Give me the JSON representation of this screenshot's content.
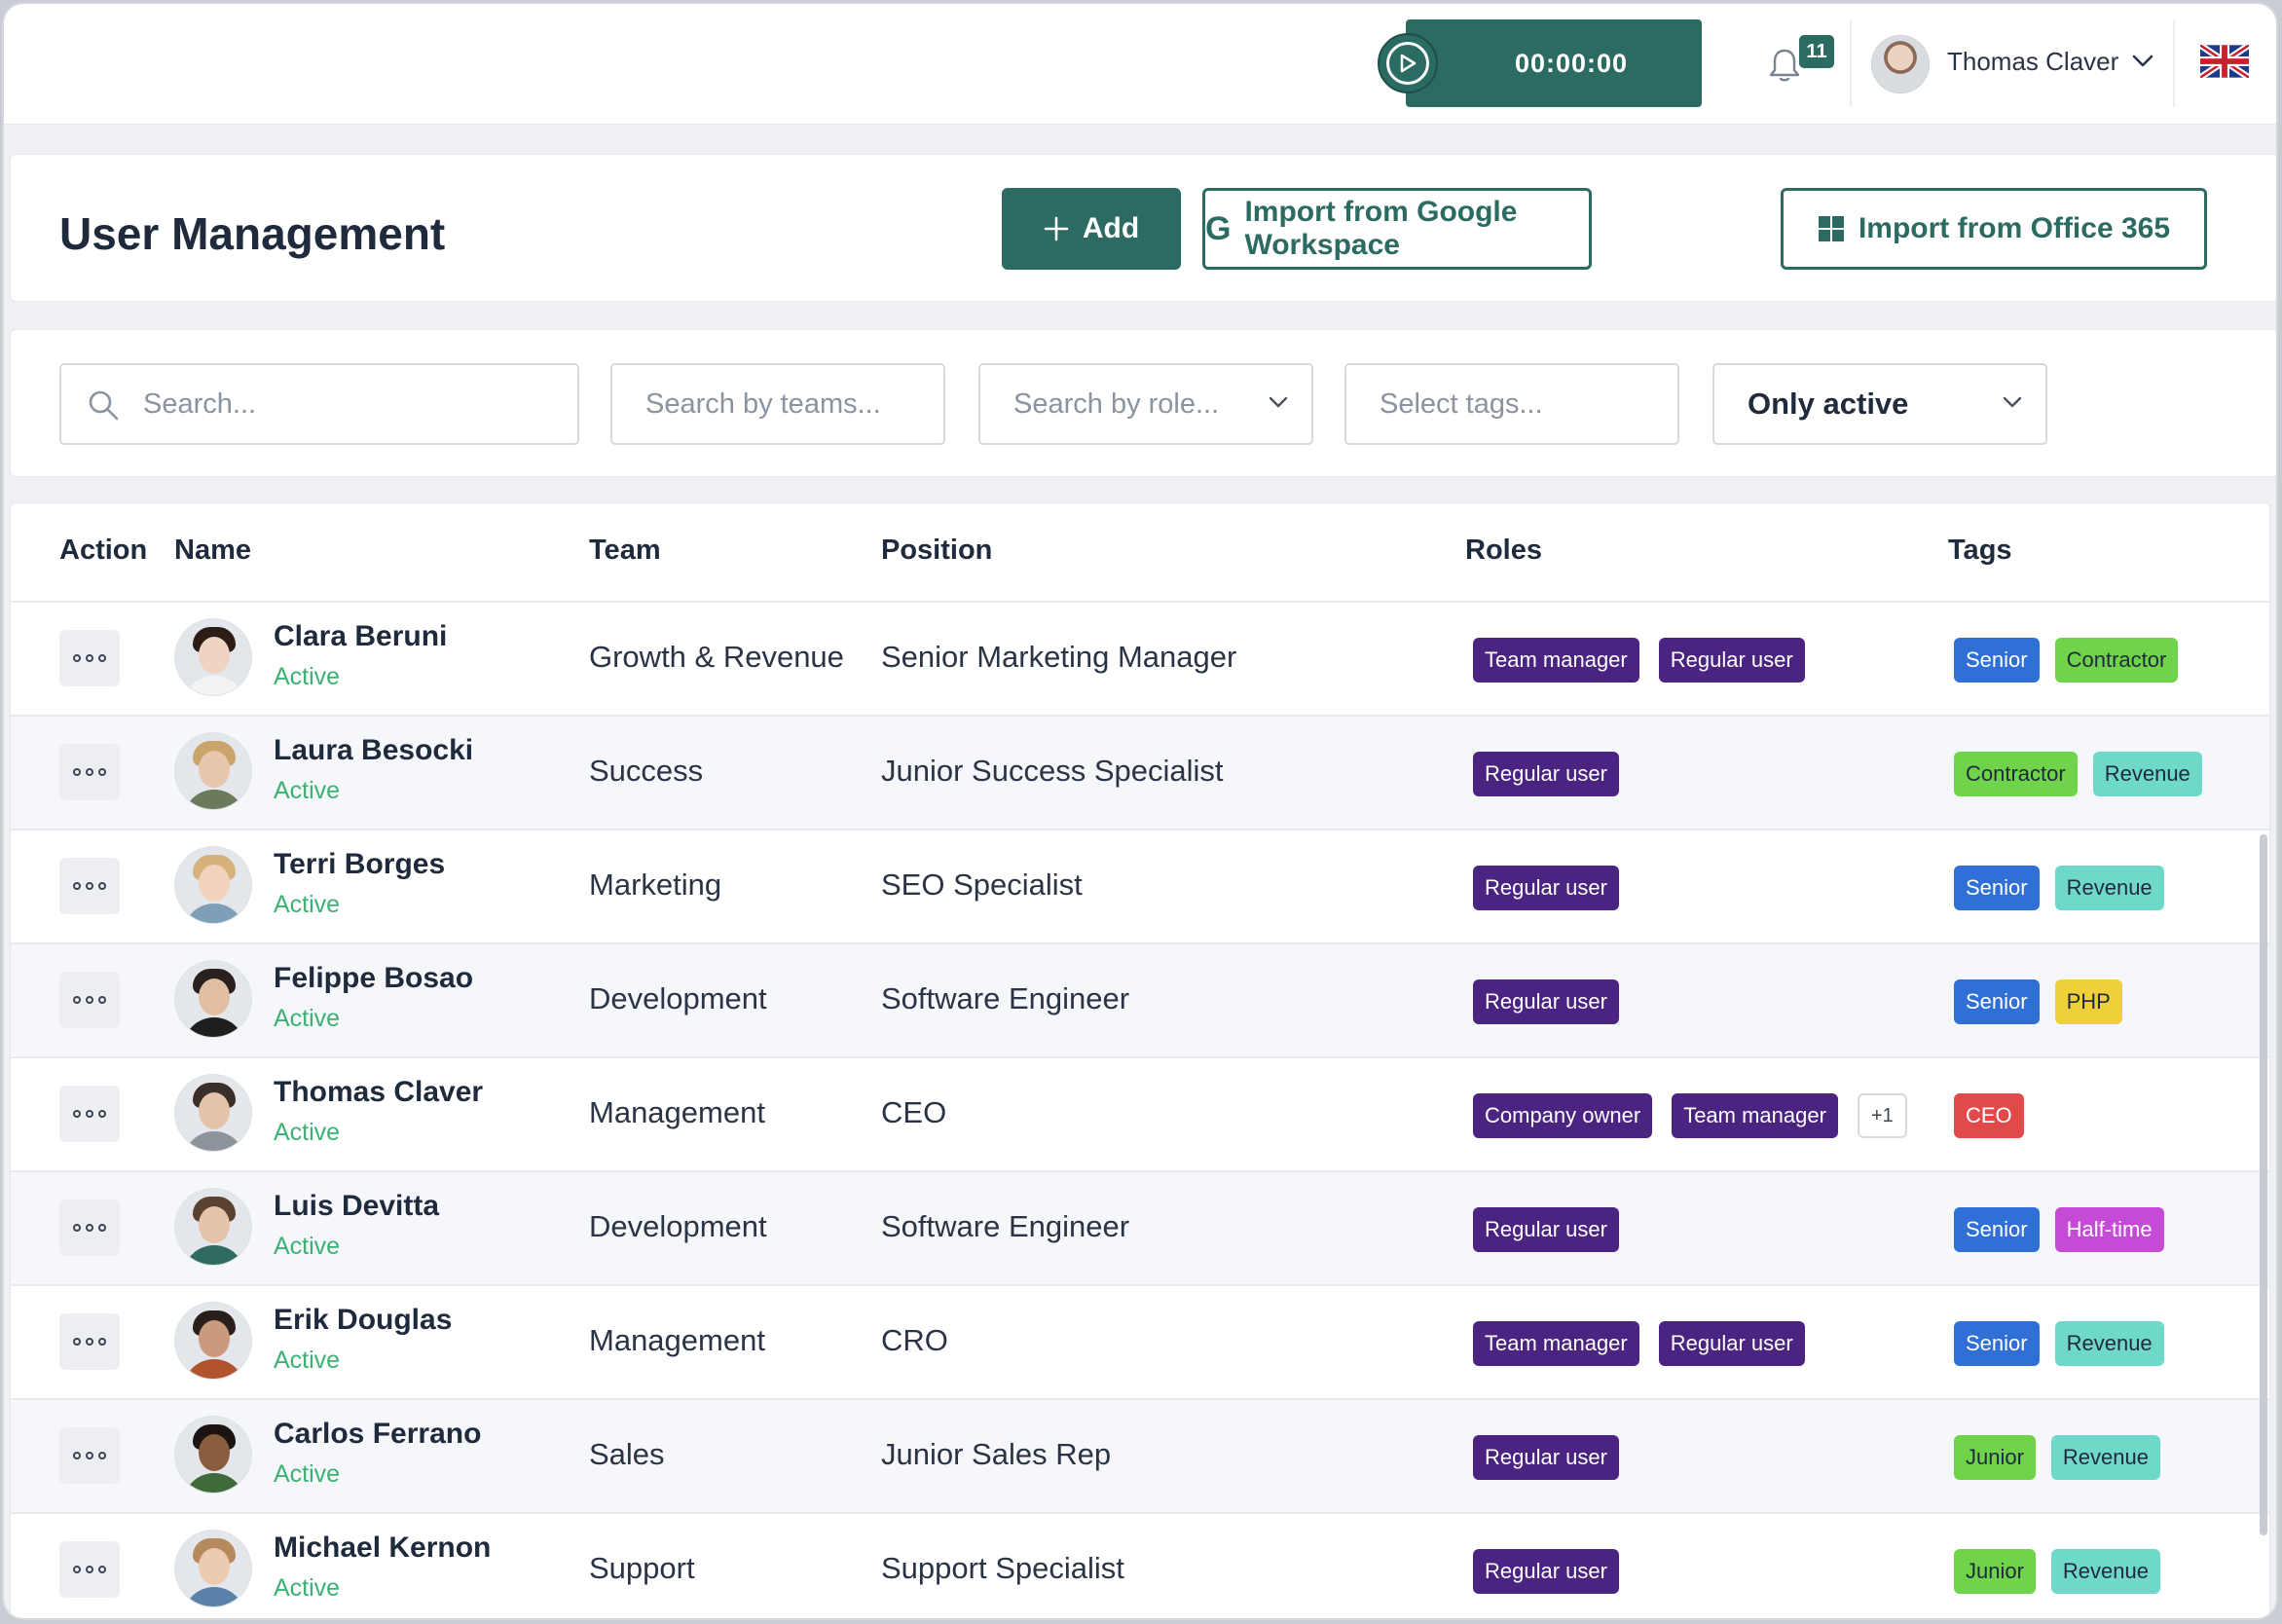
{
  "topbar": {
    "timer": "00:00:00",
    "notifications_count": "11",
    "user_name": "Thomas Claver"
  },
  "header": {
    "title": "User Management",
    "add_label": "Add",
    "google_label": "Import from Google Workspace",
    "office_label": "Import from Office 365"
  },
  "filters": {
    "search_placeholder": "Search...",
    "teams_placeholder": "Search by teams...",
    "role_placeholder": "Search by role...",
    "tags_placeholder": "Select tags...",
    "status_value": "Only active"
  },
  "table": {
    "columns": [
      "Action",
      "Name",
      "Team",
      "Position",
      "Roles",
      "Tags"
    ],
    "rows": [
      {
        "name": "Clara Beruni",
        "status": "Active",
        "team": "Growth & Revenue",
        "position": "Senior Marketing Manager",
        "roles": [
          "Team manager",
          "Regular user"
        ],
        "more": "",
        "tags": [
          {
            "label": "Senior",
            "color": "#2f6fd6"
          },
          {
            "label": "Contractor",
            "color": "#6fd44a"
          }
        ],
        "avatar": {
          "skin": "#efd4c2",
          "hair": "#2b1d16",
          "shirt": "#f3f3f3"
        }
      },
      {
        "name": "Laura Besocki",
        "status": "Active",
        "team": "Success",
        "position": "Junior Success Specialist",
        "roles": [
          "Regular user"
        ],
        "more": "",
        "tags": [
          {
            "label": "Contractor",
            "color": "#6fd44a"
          },
          {
            "label": "Revenue",
            "color": "#6fd9c9"
          }
        ],
        "avatar": {
          "skin": "#e8c6ad",
          "hair": "#c9a56a",
          "shirt": "#6a7a5a"
        }
      },
      {
        "name": "Terri Borges",
        "status": "Active",
        "team": "Marketing",
        "position": "SEO Specialist",
        "roles": [
          "Regular user"
        ],
        "more": "",
        "tags": [
          {
            "label": "Senior",
            "color": "#2f6fd6"
          },
          {
            "label": "Revenue",
            "color": "#6fd9c9"
          }
        ],
        "avatar": {
          "skin": "#f0d2bd",
          "hair": "#d6b27a",
          "shirt": "#7d9fb8"
        }
      },
      {
        "name": "Felippe Bosao",
        "status": "Active",
        "team": "Development",
        "position": "Software Engineer",
        "roles": [
          "Regular user"
        ],
        "more": "",
        "tags": [
          {
            "label": "Senior",
            "color": "#2f6fd6"
          },
          {
            "label": "PHP",
            "color": "#f0d03a"
          }
        ],
        "avatar": {
          "skin": "#e2bfa3",
          "hair": "#2a211c",
          "shirt": "#1e1e1e"
        }
      },
      {
        "name": "Thomas Claver",
        "status": "Active",
        "team": "Management",
        "position": "CEO",
        "roles": [
          "Company owner",
          "Team manager"
        ],
        "more": "+1",
        "tags": [
          {
            "label": "CEO",
            "color": "#e04a4a"
          }
        ],
        "avatar": {
          "skin": "#e4c3ab",
          "hair": "#3a2f29",
          "shirt": "#8d949c"
        }
      },
      {
        "name": "Luis Devitta",
        "status": "Active",
        "team": "Development",
        "position": "Software Engineer",
        "roles": [
          "Regular user"
        ],
        "more": "",
        "tags": [
          {
            "label": "Senior",
            "color": "#2f6fd6"
          },
          {
            "label": "Half-time",
            "color": "#c54ad6"
          }
        ],
        "avatar": {
          "skin": "#e6c4aa",
          "hair": "#5a4130",
          "shirt": "#2f6b5e"
        }
      },
      {
        "name": "Erik Douglas",
        "status": "Active",
        "team": "Management",
        "position": "CRO",
        "roles": [
          "Team manager",
          "Regular user"
        ],
        "more": "",
        "tags": [
          {
            "label": "Senior",
            "color": "#2f6fd6"
          },
          {
            "label": "Revenue",
            "color": "#6fd9c9"
          }
        ],
        "avatar": {
          "skin": "#c99a7c",
          "hair": "#2a1f1a",
          "shirt": "#b2532f"
        }
      },
      {
        "name": "Carlos Ferrano",
        "status": "Active",
        "team": "Sales",
        "position": "Junior Sales Rep",
        "roles": [
          "Regular user"
        ],
        "more": "",
        "tags": [
          {
            "label": "Junior",
            "color": "#6fd44a"
          },
          {
            "label": "Revenue",
            "color": "#6fd9c9"
          }
        ],
        "avatar": {
          "skin": "#8a5c3e",
          "hair": "#1b1411",
          "shirt": "#3e6b3a"
        }
      },
      {
        "name": "Michael Kernon",
        "status": "Active",
        "team": "Support",
        "position": "Support Specialist",
        "roles": [
          "Regular user"
        ],
        "more": "",
        "tags": [
          {
            "label": "Junior",
            "color": "#6fd44a"
          },
          {
            "label": "Revenue",
            "color": "#6fd9c9"
          }
        ],
        "avatar": {
          "skin": "#eccab0",
          "hair": "#b58a5c",
          "shirt": "#5a82a8"
        }
      }
    ]
  },
  "colors": {
    "brand": "#2c6b61",
    "role_pill": "#4a2480",
    "active_status": "#3bb273"
  }
}
